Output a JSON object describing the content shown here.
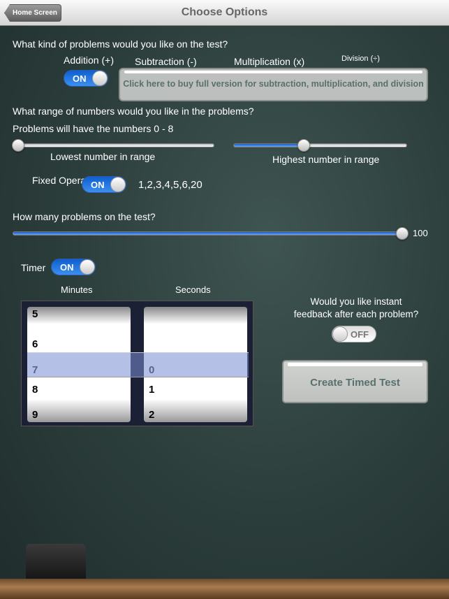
{
  "nav": {
    "back_label": "Home Screen",
    "title": "Choose Options"
  },
  "problems": {
    "question": "What kind of problems would you like on the test?",
    "types": [
      {
        "label": "Addition (+)",
        "state": "ON"
      },
      {
        "label": "Subtraction (-)",
        "state": "OFF"
      },
      {
        "label": "Multiplication (x)",
        "state": "OFF"
      },
      {
        "label": "Division (÷)",
        "state": "OFF"
      }
    ],
    "buy_label": "Click here to buy full version for subtraction, multiplication, and division"
  },
  "range": {
    "question": "What range of numbers would you like in the problems?",
    "summary": "Problems will have the numbers 0 - 8",
    "low_label": "Lowest number in range",
    "high_label": "Highest number in range",
    "low_value": 0,
    "high_value": 8
  },
  "fixed": {
    "label": "Fixed Operands",
    "state": "ON",
    "values": "1,2,3,4,5,6,20"
  },
  "count": {
    "question": "How many problems on the test?",
    "value": "100"
  },
  "timer": {
    "label": "Timer",
    "state": "ON",
    "minutes_label": "Minutes",
    "seconds_label": "Seconds",
    "minutes": [
      "5",
      "6",
      "7",
      "8",
      "9"
    ],
    "seconds": [
      "0",
      "1",
      "2"
    ],
    "selected_minutes": "7",
    "selected_seconds": "0"
  },
  "feedback": {
    "question_line1": "Would you like instant",
    "question_line2": "feedback after each problem?",
    "state": "OFF"
  },
  "create_label": "Create Timed Test",
  "colors": {
    "switch_on": "#1a6fe0",
    "chalkboard": "#2f4240"
  }
}
